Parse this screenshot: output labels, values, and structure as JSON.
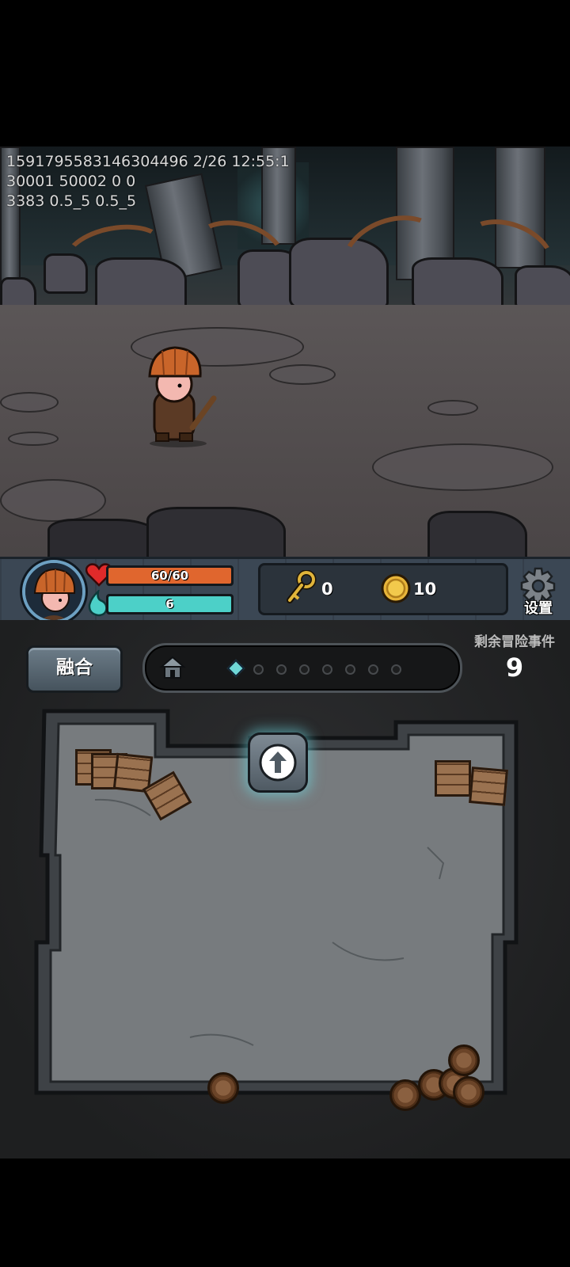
{
  "debug_overlay": {
    "lines": [
      "1591795583146304496 2/26 12:55:1",
      "30001 50002 0 0",
      "3383 0.5_5 0.5_5"
    ]
  },
  "player": {
    "avatar_icon": "pumpkin-hat-hero-portrait",
    "hp": {
      "text": "60/60",
      "current": 60,
      "max": 60,
      "color": "#e0662e"
    },
    "mana": {
      "text": "6",
      "fraction": 1.0,
      "color": "#4cd0c8"
    }
  },
  "resources": {
    "keys": {
      "icon": "key-icon",
      "count": "0"
    },
    "coins": {
      "icon": "gold-coin-icon",
      "count": "10"
    }
  },
  "settings": {
    "label": "设置",
    "icon": "gear-icon"
  },
  "fuse_button": {
    "label": "融合"
  },
  "adventure_progress": {
    "start_icon": "house-icon",
    "current_step": 1,
    "total_steps": 8
  },
  "remaining_events": {
    "label": "剩余冒险事件",
    "count": "9"
  },
  "room": {
    "exit_button_icon": "up-arrow-icon"
  }
}
